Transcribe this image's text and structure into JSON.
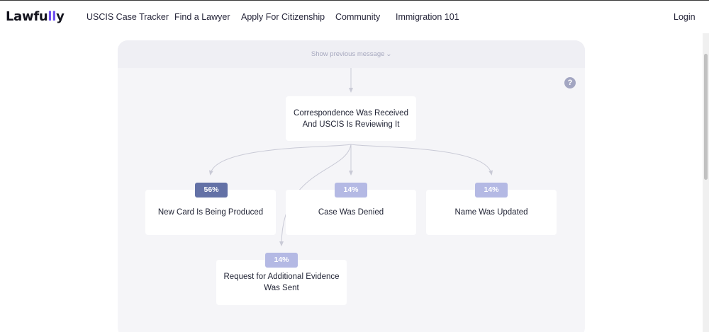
{
  "nav": {
    "logo_main": "Lawfu",
    "logo_accent": "ll",
    "logo_end": "y",
    "links": [
      "USCIS Case Tracker",
      "Find a Lawyer",
      "Apply For Citizenship",
      "Community",
      "Immigration 101"
    ],
    "login": "Login"
  },
  "panel": {
    "show_previous": "Show previous message",
    "help": "?",
    "root_status": "Correspondence Was Received And USCIS Is Reviewing It",
    "outcomes": [
      {
        "label": "New Card Is Being Produced",
        "percent": "56%"
      },
      {
        "label": "Case Was Denied",
        "percent": "14%"
      },
      {
        "label": "Name Was Updated",
        "percent": "14%"
      },
      {
        "label": "Request for Additional Evidence Was Sent",
        "percent": "14%"
      }
    ]
  },
  "colors": {
    "badge_primary": "#6371a6",
    "badge_secondary": "#b4b9e4",
    "logo_accent": "#6d4ef0"
  }
}
